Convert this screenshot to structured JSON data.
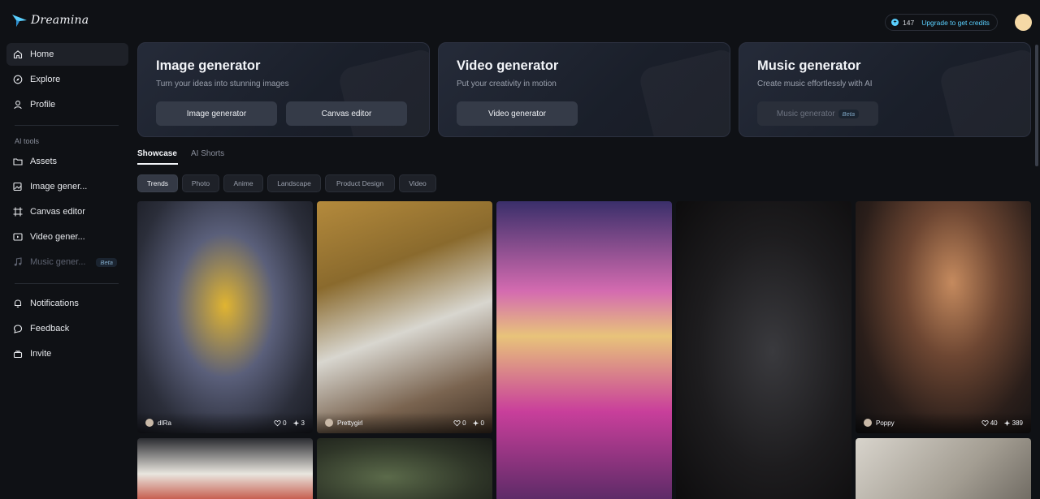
{
  "app": {
    "name": "Dreamina"
  },
  "sidebar": {
    "nav": [
      {
        "label": "Home",
        "icon": "home-icon"
      },
      {
        "label": "Explore",
        "icon": "compass-icon"
      },
      {
        "label": "Profile",
        "icon": "user-icon"
      }
    ],
    "ai_tools_label": "AI tools",
    "tools": [
      {
        "label": "Assets",
        "icon": "folder-icon"
      },
      {
        "label": "Image gener...",
        "icon": "image-icon"
      },
      {
        "label": "Canvas editor",
        "icon": "canvas-icon"
      },
      {
        "label": "Video gener...",
        "icon": "video-icon"
      },
      {
        "label": "Music gener...",
        "icon": "music-icon",
        "badge": "Beta"
      }
    ],
    "bottom": [
      {
        "label": "Notifications",
        "icon": "bell-icon"
      },
      {
        "label": "Feedback",
        "icon": "chat-icon"
      },
      {
        "label": "Invite",
        "icon": "gift-icon"
      }
    ]
  },
  "header": {
    "credits": "147",
    "upgrade_label": "Upgrade to get credits"
  },
  "generators": [
    {
      "title": "Image generator",
      "subtitle": "Turn your ideas into stunning images",
      "buttons": [
        "Image generator",
        "Canvas editor"
      ]
    },
    {
      "title": "Video generator",
      "subtitle": "Put your creativity in motion",
      "buttons": [
        "Video generator"
      ]
    },
    {
      "title": "Music generator",
      "subtitle": "Create music effortlessly with AI",
      "buttons": [
        "Music generator"
      ],
      "badge": "Beta"
    }
  ],
  "tabs": [
    "Showcase",
    "AI Shorts"
  ],
  "filters": [
    "Trends",
    "Photo",
    "Anime",
    "Landscape",
    "Product Design",
    "Video"
  ],
  "gallery": [
    {
      "user": "dIRa",
      "likes": "0",
      "uses": "3"
    },
    {
      "user": "Prettygirl",
      "likes": "0",
      "uses": "0"
    },
    {
      "user": "",
      "likes": "",
      "uses": ""
    },
    {
      "user": "",
      "likes": "",
      "uses": ""
    },
    {
      "user": "Poppy",
      "likes": "40",
      "uses": "389"
    }
  ],
  "colors": {
    "accent": "#5ad0ff",
    "background": "#0f1115",
    "card": "#1e2128"
  }
}
